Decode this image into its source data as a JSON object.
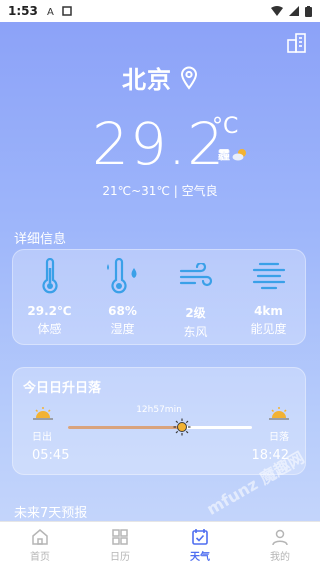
{
  "status_bar": {
    "time": "1:53"
  },
  "location": {
    "city": "北京"
  },
  "current": {
    "temperature": "29.2",
    "unit": "°C",
    "condition": "霾",
    "range_line": "21℃~31℃ | 空气良"
  },
  "details": {
    "title": "详细信息",
    "items": [
      {
        "value": "29.2℃",
        "label": "体感",
        "icon": "thermometer-icon"
      },
      {
        "value": "68%",
        "label": "湿度",
        "icon": "humidity-icon"
      },
      {
        "value": "2级",
        "label": "东风",
        "icon": "wind-icon"
      },
      {
        "value": "4km",
        "label": "能见度",
        "icon": "visibility-icon"
      }
    ]
  },
  "sun": {
    "title": "今日日升日落",
    "duration": "12h57min",
    "sunrise_label": "日出",
    "sunset_label": "日落",
    "sunrise_time": "05:45",
    "sunset_time": "18:42",
    "progress": 0.62
  },
  "forecast": {
    "title": "未来7天预报"
  },
  "watermark": "mfunz 魔趣网",
  "tabs": [
    {
      "label": "首页",
      "icon": "home-icon"
    },
    {
      "label": "日历",
      "icon": "calendar-grid-icon"
    },
    {
      "label": "天气",
      "icon": "weather-calendar-icon",
      "active": true
    },
    {
      "label": "我的",
      "icon": "profile-icon"
    }
  ],
  "colors": {
    "accent": "#4f6ef0",
    "sun_track_fill": "#d9a37d",
    "sun_icon": "#f2b233"
  }
}
